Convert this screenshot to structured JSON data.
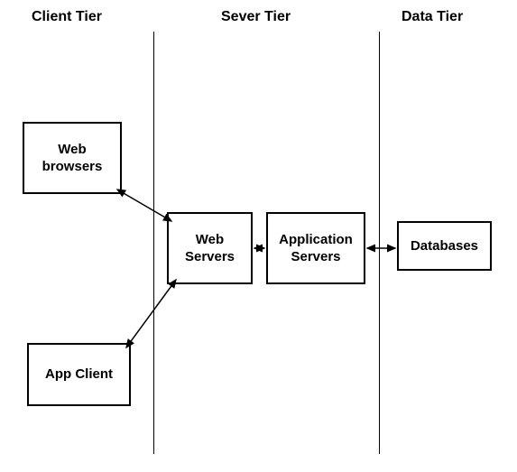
{
  "tiers": {
    "client": "Client Tier",
    "server": "Sever Tier",
    "data": "Data Tier"
  },
  "nodes": {
    "webBrowsers": "Web browsers",
    "appClient": "App Client",
    "webServers": "Web Servers",
    "appServers": "Application Servers",
    "databases": "Databases"
  }
}
